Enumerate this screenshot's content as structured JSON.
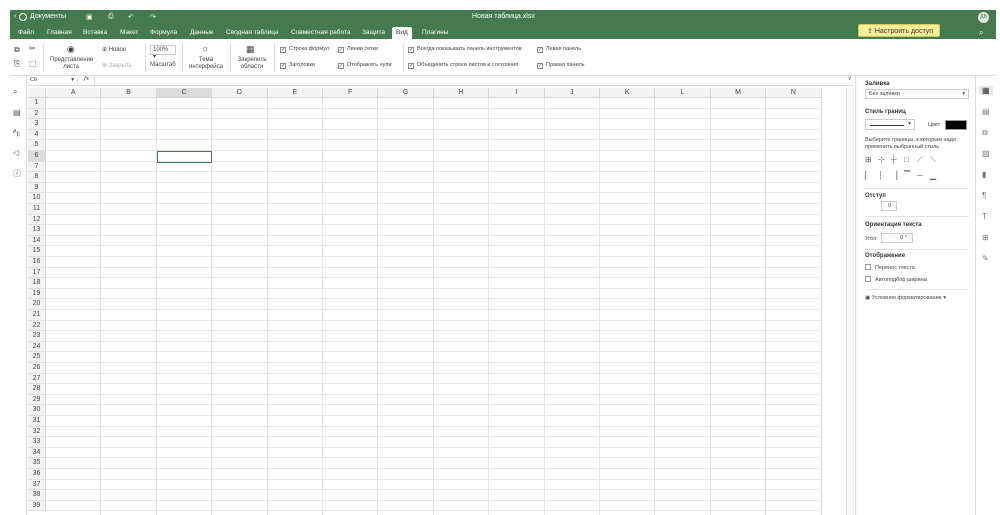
{
  "titlebar": {
    "docs": "Документы",
    "filename": "Новая таблица.xlsx",
    "avatar": "ДВ"
  },
  "tabs": [
    "Файл",
    "Главная",
    "Вставка",
    "Макет",
    "Формула",
    "Данные",
    "Сводная таблица",
    "Совместная работа",
    "Защита",
    "Вид",
    "Плагины"
  ],
  "active_tab": "Вид",
  "access_button": "Настроить доступ",
  "toolbar": {
    "sheet_view": "Представление листа",
    "new": "Новое",
    "close": "Закрыть",
    "zoom_value": "100%",
    "zoom_label": "Масштаб",
    "theme": "Тема интерфейса",
    "freeze": "Закрепить области",
    "cb_formula_bar": "Строка формул",
    "cb_gridlines": "Линии сетки",
    "cb_headings": "Заголовки",
    "cb_zeros": "Отображать нули",
    "cb_toolbar": "Всегда показывать панель инструментов",
    "cb_combine": "Объединить строки листов и состояния",
    "cb_left": "Левая панель",
    "cb_right": "Правая панель"
  },
  "formula": {
    "cell_ref": "C6",
    "fx": "fx"
  },
  "columns": [
    "A",
    "B",
    "C",
    "D",
    "E",
    "F",
    "G",
    "H",
    "I",
    "J",
    "K",
    "L",
    "M",
    "N"
  ],
  "rows": [
    "1",
    "2",
    "3",
    "4",
    "5",
    "6",
    "7",
    "8",
    "9",
    "10",
    "11",
    "12",
    "13",
    "14",
    "15",
    "16",
    "17",
    "18",
    "19",
    "20",
    "21",
    "22",
    "23",
    "24",
    "25",
    "26",
    "27",
    "28",
    "29",
    "30",
    "31",
    "32",
    "33",
    "34",
    "35",
    "36",
    "37",
    "38",
    "39"
  ],
  "right_panel": {
    "fill_title": "Заливка",
    "fill_value": "Без заливки",
    "border_title": "Стиль границ",
    "color_label": "Цвет",
    "border_hint": "Выберите границы, к которым надо применить выбранный стиль",
    "indent_title": "Отступ",
    "indent_value": "0",
    "orient_title": "Ориентация текста",
    "angle_label": "Угол",
    "angle_value": "0 °",
    "display_title": "Отображение",
    "wrap": "Перенос текста",
    "autofit": "Автоподбор ширины",
    "cond_format": "Условное форматирование"
  },
  "colors": {
    "brand": "#447a4e",
    "access": "#f9ee9a"
  }
}
